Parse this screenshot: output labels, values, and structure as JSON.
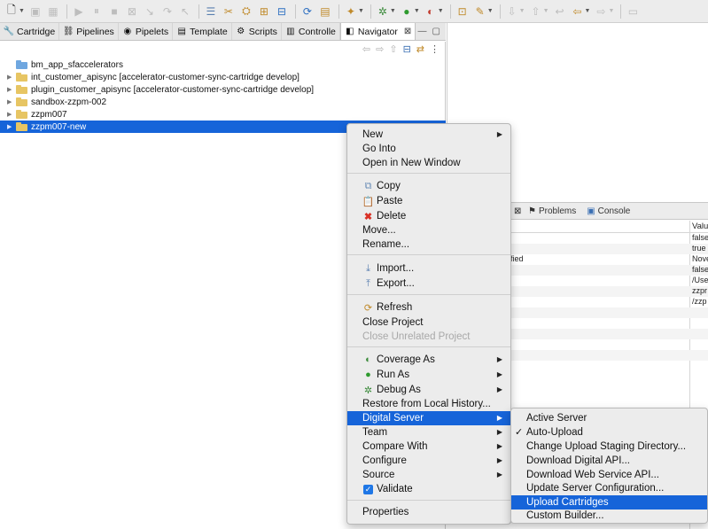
{
  "tabs": [
    {
      "label": "Cartridge",
      "icon": "cartridge-icon",
      "glyph": "🔧"
    },
    {
      "label": "Pipelines",
      "icon": "pipelines-icon",
      "glyph": "⛓"
    },
    {
      "label": "Pipelets",
      "icon": "pipelets-icon",
      "glyph": "◉"
    },
    {
      "label": "Template",
      "icon": "template-icon",
      "glyph": "▤"
    },
    {
      "label": "Scripts",
      "icon": "scripts-icon",
      "glyph": "⚙"
    },
    {
      "label": "Controlle",
      "icon": "controller-icon",
      "glyph": "▥"
    },
    {
      "label": "Navigator",
      "icon": "navigator-icon",
      "glyph": "◧",
      "active": true
    }
  ],
  "tree": [
    {
      "label": "bm_app_sfaccelerators",
      "twisty": false,
      "project": false
    },
    {
      "label": "int_customer_apisync [accelerator-customer-sync-cartridge develop]",
      "twisty": true,
      "project": true
    },
    {
      "label": "plugin_customer_apisync [accelerator-customer-sync-cartridge develop]",
      "twisty": true,
      "project": true
    },
    {
      "label": "sandbox-zzpm-002",
      "twisty": true,
      "project": true
    },
    {
      "label": "zzpm007",
      "twisty": true,
      "project": true
    },
    {
      "label": "zzpm007-new",
      "twisty": true,
      "project": true,
      "selected": true
    }
  ],
  "bottom_tabs": {
    "problems": "Problems",
    "console": "Console"
  },
  "properties": {
    "value_header": "Valu",
    "rows": [
      {
        "key": "",
        "value": "false"
      },
      {
        "key": "",
        "value": "true"
      },
      {
        "key": "fied",
        "value": "Nove"
      },
      {
        "key": "",
        "value": "false"
      },
      {
        "key": "",
        "value": "/Use"
      },
      {
        "key": "",
        "value": "zzpr"
      },
      {
        "key": "",
        "value": "/zzp"
      }
    ]
  },
  "context_menu": {
    "new": "New",
    "go_into": "Go Into",
    "open_new_window": "Open in New Window",
    "copy": "Copy",
    "paste": "Paste",
    "delete": "Delete",
    "move": "Move...",
    "rename": "Rename...",
    "import": "Import...",
    "export": "Export...",
    "refresh": "Refresh",
    "close_project": "Close Project",
    "close_unrelated": "Close Unrelated Project",
    "coverage_as": "Coverage As",
    "run_as": "Run As",
    "debug_as": "Debug As",
    "restore_history": "Restore from Local History...",
    "digital_server": "Digital Server",
    "team": "Team",
    "compare_with": "Compare With",
    "configure": "Configure",
    "source": "Source",
    "validate": "Validate",
    "properties": "Properties"
  },
  "submenu": {
    "active_server": "Active Server",
    "auto_upload": "Auto-Upload",
    "change_staging": "Change Upload Staging Directory...",
    "download_digital_api": "Download Digital API...",
    "download_ws_api": "Download Web Service API...",
    "update_server_config": "Update Server Configuration...",
    "upload_cartridges": "Upload Cartridges",
    "custom_builder": "Custom Builder..."
  },
  "colors": {
    "selection": "#1664d9",
    "menu_bg": "#ececec"
  }
}
